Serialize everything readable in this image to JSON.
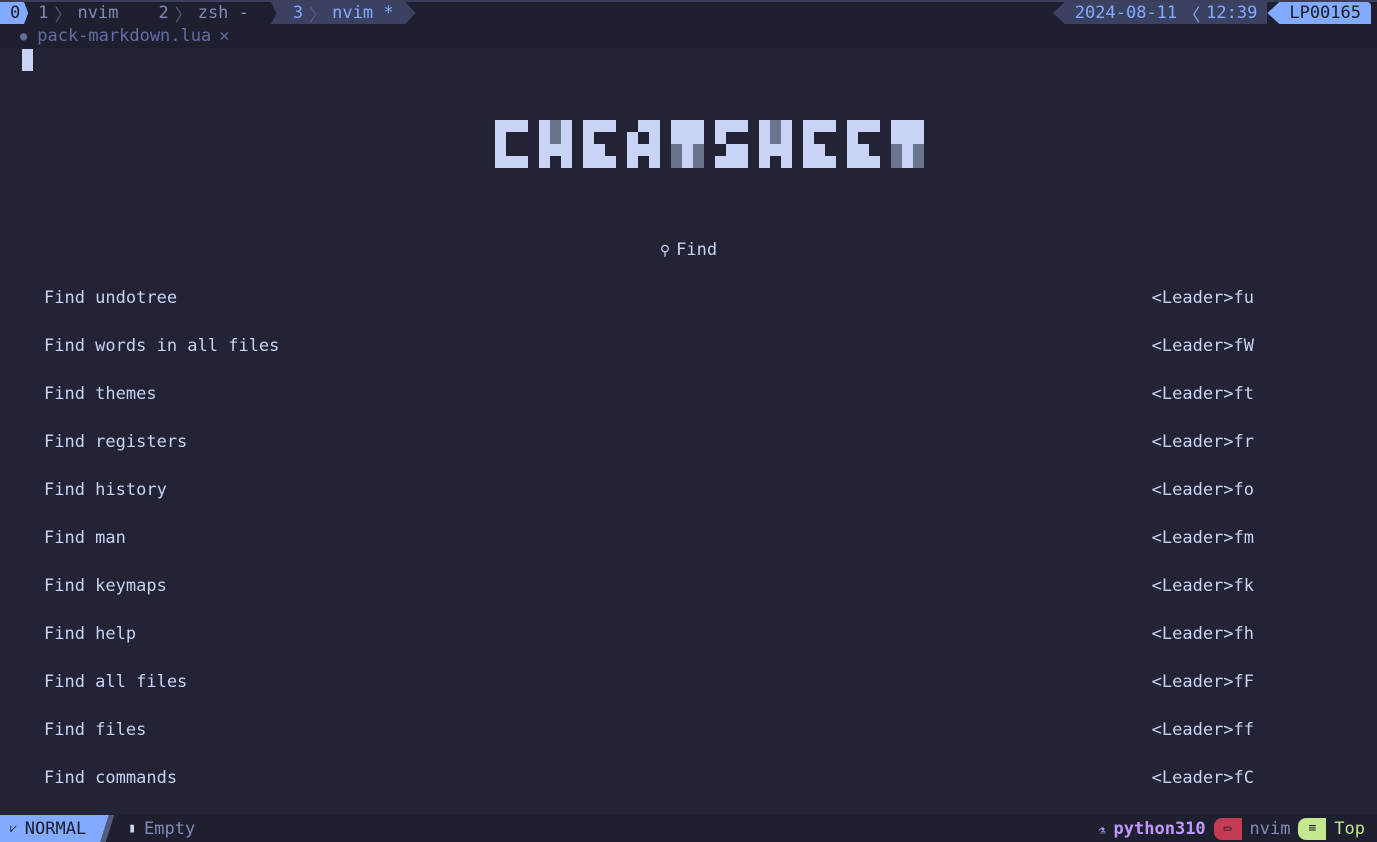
{
  "tmux": {
    "session": "0",
    "windows": [
      {
        "index": "1",
        "name": "nvim"
      },
      {
        "index": "2",
        "name": "zsh -"
      },
      {
        "index": "3",
        "name": "nvim *"
      }
    ],
    "date": "2024-08-11",
    "time": "12:39",
    "host": "LP00165"
  },
  "buffer": {
    "name": "pack-markdown.lua",
    "close": "✕"
  },
  "logo": "CHEATSHEET",
  "section": {
    "icon": "search-icon",
    "title": "Find"
  },
  "items": [
    {
      "label": "Find undotree",
      "key": "<Leader>fu"
    },
    {
      "label": "Find words in all files",
      "key": "<Leader>fW"
    },
    {
      "label": "Find themes",
      "key": "<Leader>ft"
    },
    {
      "label": "Find registers",
      "key": "<Leader>fr"
    },
    {
      "label": "Find history",
      "key": "<Leader>fo"
    },
    {
      "label": "Find man",
      "key": "<Leader>fm"
    },
    {
      "label": "Find keymaps",
      "key": "<Leader>fk"
    },
    {
      "label": "Find help",
      "key": "<Leader>fh"
    },
    {
      "label": "Find all files",
      "key": "<Leader>fF"
    },
    {
      "label": "Find files",
      "key": "<Leader>ff"
    },
    {
      "label": "Find commands",
      "key": "<Leader>fC"
    }
  ],
  "statusline": {
    "mode": "NORMAL",
    "file": "Empty",
    "env": "python310",
    "cwd": "nvim",
    "position": "Top"
  },
  "colors": {
    "bg": "#222436",
    "accent": "#82aaff",
    "text": "#c8d3f5",
    "env": "#c099ff",
    "cwd": "#c53b53",
    "pos": "#c3e88d"
  }
}
